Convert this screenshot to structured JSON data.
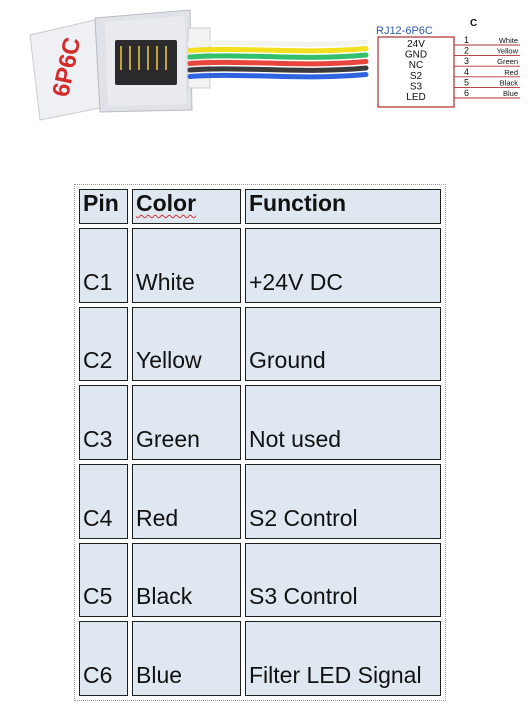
{
  "connector": {
    "label": "6P6C",
    "wire_colors": [
      "#f4f4ee",
      "#f2df1e",
      "#34c06a",
      "#e8463c",
      "#3b3b3b",
      "#2f64e0"
    ]
  },
  "schematic": {
    "title": "RJ12-6P6C",
    "header": "C",
    "signals": [
      "24V",
      "GND",
      "NC",
      "S2",
      "S3",
      "LED"
    ],
    "pins": [
      {
        "num": "1",
        "color": "White"
      },
      {
        "num": "2",
        "color": "Yellow"
      },
      {
        "num": "3",
        "color": "Green"
      },
      {
        "num": "4",
        "color": "Red"
      },
      {
        "num": "5",
        "color": "Black"
      },
      {
        "num": "6",
        "color": "Blue"
      }
    ],
    "title_color": "#2f5aa8",
    "box_color": "#b03030"
  },
  "table": {
    "headers": {
      "pin": "Pin",
      "color": "Color",
      "function": "Function"
    },
    "rows": [
      {
        "pin": "C1",
        "color": "White",
        "function": "+24V DC"
      },
      {
        "pin": "C2",
        "color": "Yellow",
        "function": "Ground"
      },
      {
        "pin": "C3",
        "color": "Green",
        "function": "Not used"
      },
      {
        "pin": "C4",
        "color": "Red",
        "function": "S2 Control"
      },
      {
        "pin": "C5",
        "color": "Black",
        "function": "S3 Control"
      },
      {
        "pin": "C6",
        "color": "Blue",
        "function": "Filter LED Signal"
      }
    ],
    "cell_color": "#dfe8f1"
  }
}
